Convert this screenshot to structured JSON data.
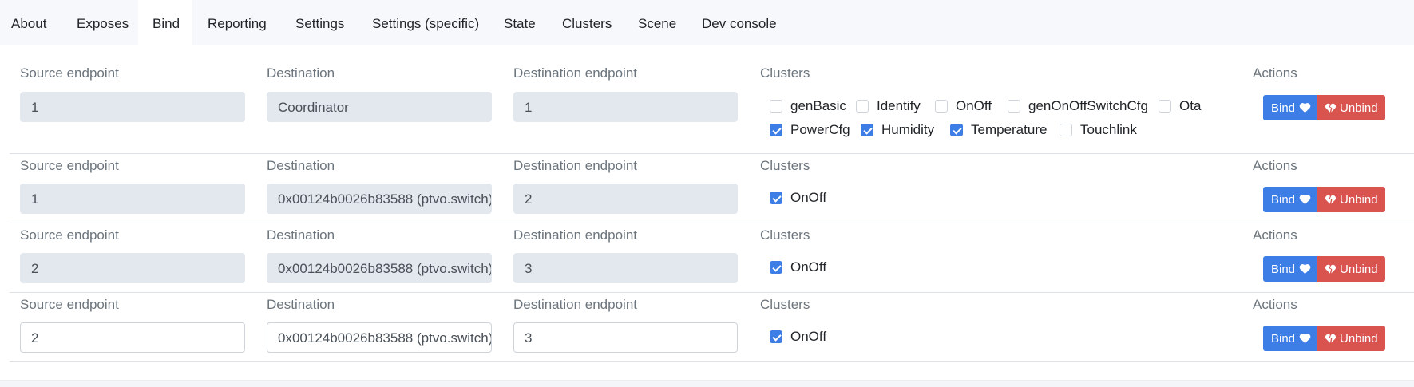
{
  "tabs": [
    {
      "label": "About",
      "active": false
    },
    {
      "label": "Exposes",
      "active": false
    },
    {
      "label": "Bind",
      "active": true
    },
    {
      "label": "Reporting",
      "active": false
    },
    {
      "label": "Settings",
      "active": false
    },
    {
      "label": "Settings (specific)",
      "active": false
    },
    {
      "label": "State",
      "active": false
    },
    {
      "label": "Clusters",
      "active": false
    },
    {
      "label": "Scene",
      "active": false
    },
    {
      "label": "Dev console",
      "active": false
    }
  ],
  "column_labels": {
    "source": "Source endpoint",
    "destination": "Destination",
    "dest_endpoint": "Destination endpoint",
    "clusters": "Clusters",
    "actions": "Actions"
  },
  "buttons": {
    "bind": "Bind",
    "unbind": "Unbind"
  },
  "icons": {
    "bind": "heart-icon",
    "unbind": "heart-broken-icon"
  },
  "colors": {
    "primary": "#3d7ee6",
    "danger": "#d9534f",
    "disabled_field": "#e3e7ee"
  },
  "rows": [
    {
      "source": "1",
      "destination": "Coordinator",
      "dest_endpoint": "1",
      "editable": false,
      "clusters": [
        {
          "name": "genBasic",
          "checked": false
        },
        {
          "name": "Identify",
          "checked": false
        },
        {
          "name": "OnOff",
          "checked": false
        },
        {
          "name": "genOnOffSwitchCfg",
          "checked": false
        },
        {
          "name": "Ota",
          "checked": false
        },
        {
          "name": "PowerCfg",
          "checked": true
        },
        {
          "name": "Humidity",
          "checked": true
        },
        {
          "name": "Temperature",
          "checked": true
        },
        {
          "name": "Touchlink",
          "checked": false
        }
      ]
    },
    {
      "source": "1",
      "destination": "0x00124b0026b83588 (ptvo.switch)",
      "dest_endpoint": "2",
      "editable": false,
      "clusters": [
        {
          "name": "OnOff",
          "checked": true
        }
      ]
    },
    {
      "source": "2",
      "destination": "0x00124b0026b83588 (ptvo.switch)",
      "dest_endpoint": "3",
      "editable": false,
      "clusters": [
        {
          "name": "OnOff",
          "checked": true
        }
      ]
    },
    {
      "source": "2",
      "destination": "0x00124b0026b83588 (ptvo.switch)",
      "dest_endpoint": "3",
      "editable": true,
      "clusters": [
        {
          "name": "OnOff",
          "checked": true
        }
      ]
    }
  ]
}
